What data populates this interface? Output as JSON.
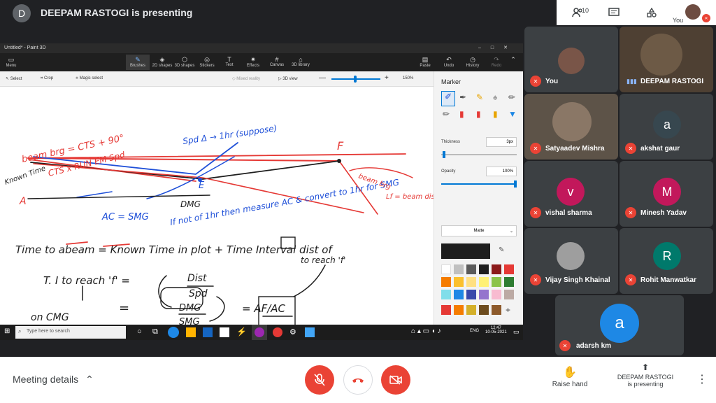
{
  "header": {
    "avatar_letter": "D",
    "title": "DEEPAM RASTOGI is presenting",
    "participant_count": "10",
    "self_label": "You"
  },
  "paint": {
    "title": "Untitled* - Paint 3D",
    "ribbon": [
      "Menu",
      "Brushes",
      "2D shapes",
      "3D shapes",
      "Stickers",
      "Text",
      "Effects",
      "Canvas",
      "3D library",
      "Paste",
      "Undo",
      "History",
      "Redo"
    ],
    "toolbar": {
      "select": "Select",
      "crop": "Crop",
      "magic_select": "Magic select",
      "mixed_reality": "Mixed reality",
      "view_3d": "3D view",
      "zoom": "150%"
    },
    "panel": {
      "title": "Marker",
      "thickness_label": "Thickness",
      "thickness_value": "3px",
      "opacity_label": "Opacity",
      "opacity_value": "100%",
      "finish": "Matte"
    },
    "taskbar": {
      "search": "Type here to search",
      "lang": "ENG",
      "time": "12:47",
      "date": "10-05-2021"
    },
    "whiteboard": {
      "t1": "beam brg = CTS + 90°",
      "t2": "CTS x RUN EM Spd",
      "t3": "Spd Δ → 1hr (suppose)",
      "t4": "F",
      "t5": "Known Time",
      "t6": "A",
      "t7": "E",
      "t8": "AC = SMG",
      "t9": "DMG",
      "t10": "If not of 1hr then measure AC & convert to 1hr for SMG",
      "t11": "beam brg",
      "t12": "Lf = beam dist",
      "t13": "Time to abeam = Known Time in plot + Time Interval dist of",
      "t14": "to reach 'f'",
      "t15": "T. I to reach 'f' =",
      "t16": "Dist",
      "t17": "Spd",
      "t18": "on CMG",
      "t19": "=",
      "t20": "DMG",
      "t21": "SMG",
      "t22": "= AF/AC"
    }
  },
  "participants": [
    {
      "name": "You",
      "muted": true
    },
    {
      "name": "DEEPAM RASTOGI",
      "muted": false
    },
    {
      "name": "Satyaadev Mishra",
      "muted": true
    },
    {
      "name": "akshat gaur",
      "letter": "a",
      "color": "#37474f",
      "muted": true
    },
    {
      "name": "vishal sharma",
      "letter": "v",
      "color": "#c2185b",
      "muted": true
    },
    {
      "name": "Minesh Yadav",
      "letter": "M",
      "color": "#c2185b",
      "muted": true
    },
    {
      "name": "Vijay Singh Khainal",
      "muted": true
    },
    {
      "name": "Rohit Manwatkar",
      "letter": "R",
      "color": "#00796b",
      "muted": true
    },
    {
      "name": "adarsh km",
      "letter": "a",
      "color": "#1e88e5",
      "muted": true
    }
  ],
  "bottom": {
    "meeting_details": "Meeting details",
    "raise_hand": "Raise hand",
    "presenting_line1": "DEEPAM RASTOGI",
    "presenting_line2": "is presenting"
  },
  "colors": {
    "end_call": "#ea4335",
    "accent": "#1a73e8"
  }
}
